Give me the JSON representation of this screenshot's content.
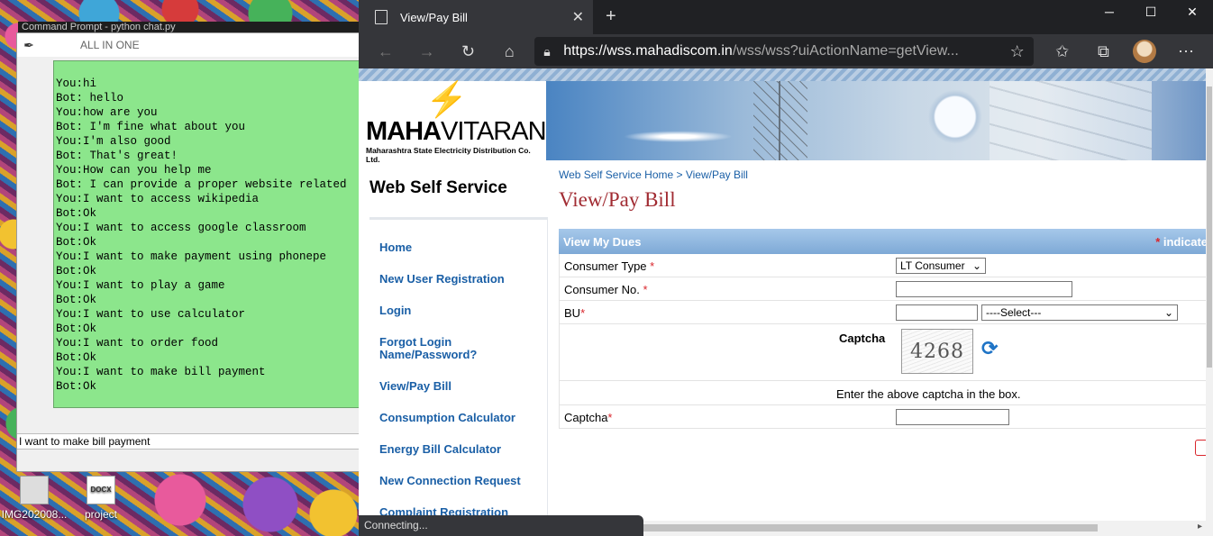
{
  "desktop": {
    "icons": [
      {
        "label": "IMG202008...",
        "type": "image"
      },
      {
        "label": "project",
        "type": "DOCX"
      }
    ],
    "behind_window_title": "Command Prompt - python chat.py"
  },
  "chat_window": {
    "title": "ALL IN ONE",
    "icon": "feather-icon",
    "messages": [
      "You:hi",
      "Bot: hello",
      "You:how are you",
      "Bot: I'm fine what about you",
      "You:I'm also good",
      "Bot: That's great!",
      "You:How can you help me",
      "Bot: I can provide a proper website related",
      "You:I want to access wikipedia",
      "Bot:Ok",
      "You:I want to access google classroom",
      "Bot:Ok",
      "You:I want to make payment using phonepe",
      "Bot:Ok",
      "You:I want to play a game",
      "Bot:Ok",
      "You:I want to use calculator",
      "Bot:Ok",
      "You:I want to order food",
      "Bot:Ok",
      "You:I want to make bill payment",
      "Bot:Ok"
    ],
    "input_value": "I want to make bill payment",
    "chat_bg": "#8ce68c"
  },
  "browser": {
    "tab_title": "View/Pay Bill",
    "new_tab": "+",
    "url_prefix": "https://",
    "url_host": "wss.mahadiscom.in",
    "url_rest": "/wss/wss?uiActionName=getView...",
    "status_text": "Connecting...",
    "window_controls": [
      "─",
      "☐",
      "✕"
    ]
  },
  "site": {
    "logo_maha": "MAHA",
    "logo_vitaran": "VITARAN",
    "logo_sub": "Maharashtra State Electricity Distribution Co. Ltd.",
    "site_name": "Web Self Service",
    "breadcrumb": "Web Self Service Home  >  View/Pay Bill",
    "page_title": "View/Pay Bill",
    "nav": [
      "Home",
      "New User Registration",
      "Login",
      "Forgot Login Name/Password?",
      "View/Pay Bill",
      "Consumption Calculator",
      "Energy Bill Calculator",
      "New Connection Request",
      "Complaint Registration"
    ],
    "form": {
      "header": "View My Dues",
      "header_note": "indicate",
      "consumer_type_label": "Consumer Type",
      "consumer_type_value": "LT Consumer",
      "consumer_no_label": "Consumer No.",
      "bu_label": "BU",
      "bu_select_value": "----Select---",
      "captcha_title": "Captcha",
      "captcha_code": "4268",
      "captcha_hint": "Enter the above captcha in the box.",
      "captcha_label": "Captcha",
      "required_mark": "*"
    },
    "accent_color": "#a12b32",
    "link_color": "#1a5fa6"
  }
}
